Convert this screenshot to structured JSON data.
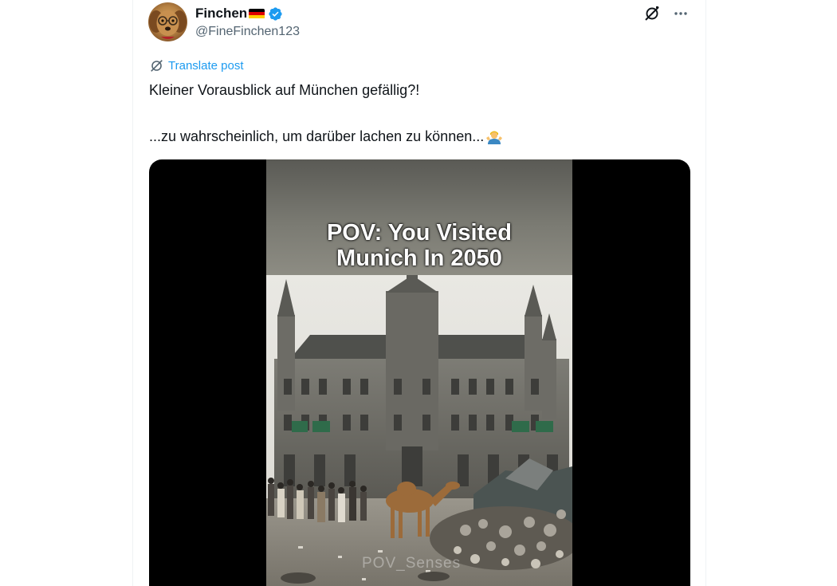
{
  "author": {
    "display_name": "Finchen",
    "handle": "@FineFinchen123",
    "verified": true,
    "flag": "germany-flag"
  },
  "actions": {
    "grok_icon": "grok-icon",
    "more_icon": "more-icon"
  },
  "translate_label": "Translate post",
  "tweet": {
    "line1": "Kleiner Vorausblick auf München gefällig?!",
    "line2": "...zu wahrscheinlich, um darüber lachen zu können...",
    "emoji": "person-shrugging-emoji"
  },
  "video": {
    "caption_line1": "POV: You Visited",
    "caption_line2": "Munich In 2050",
    "watermark": "POV_Senses"
  },
  "colors": {
    "accent": "#1d9bf0",
    "text": "#0f1419",
    "secondary": "#536471"
  }
}
